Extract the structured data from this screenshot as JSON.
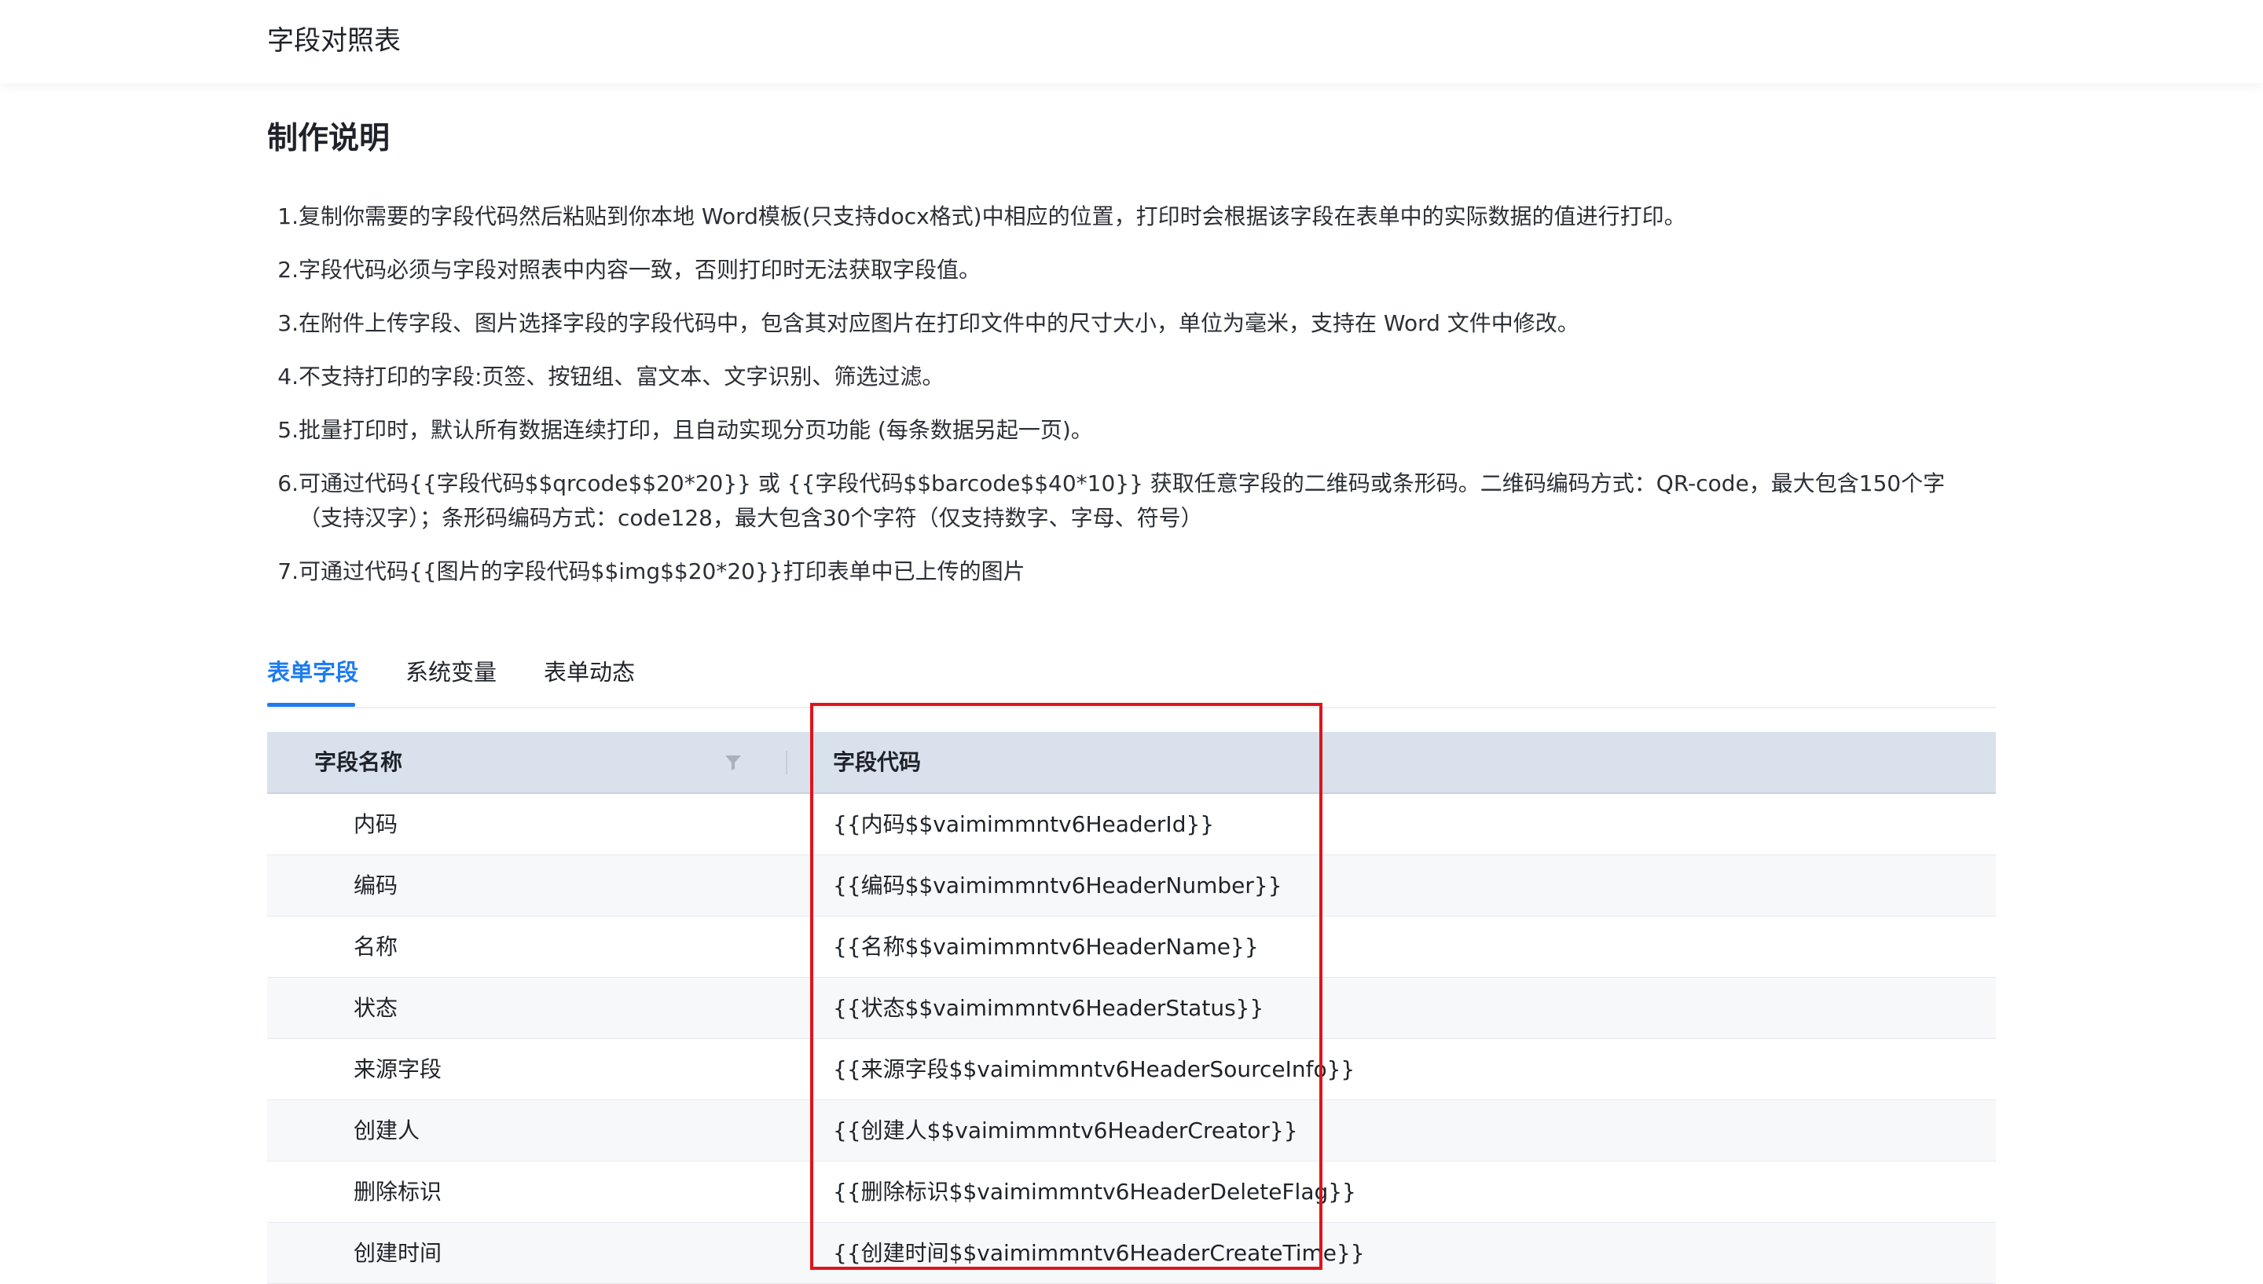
{
  "header": {
    "title": "字段对照表"
  },
  "instructions": {
    "title": "制作说明",
    "items": [
      {
        "num": "1.",
        "text": "复制你需要的字段代码然后粘贴到你本地 Word模板(只支持docx格式)中相应的位置，打印时会根据该字段在表单中的实际数据的值进行打印。"
      },
      {
        "num": "2.",
        "text": "字段代码必须与字段对照表中内容一致，否则打印时无法获取字段值。"
      },
      {
        "num": "3.",
        "text": "在附件上传字段、图片选择字段的字段代码中，包含其对应图片在打印文件中的尺寸大小，单位为毫米，支持在 Word 文件中修改。"
      },
      {
        "num": "4.",
        "text": "不支持打印的字段:页签、按钮组、富文本、文字识别、筛选过滤。"
      },
      {
        "num": "5.",
        "text": "批量打印时，默认所有数据连续打印，且自动实现分页功能 (每条数据另起一页)。"
      },
      {
        "num": "6.",
        "text": "可通过代码{{字段代码$$qrcode$$20*20}} 或 {{字段代码$$barcode$$40*10}} 获取任意字段的二维码或条形码。二维码编码方式：QR-code，最大包含150个字（支持汉字）；条形码编码方式：code128，最大包含30个字符（仅支持数字、字母、符号）"
      },
      {
        "num": "7.",
        "text": "可通过代码{{图片的字段代码$$img$$20*20}}打印表单中已上传的图片"
      }
    ]
  },
  "tabs": [
    {
      "label": "表单字段",
      "active": true
    },
    {
      "label": "系统变量",
      "active": false
    },
    {
      "label": "表单动态",
      "active": false
    }
  ],
  "table": {
    "columns": {
      "name": "字段名称",
      "code": "字段代码"
    },
    "rows": [
      {
        "name": "内码",
        "code": "{{内码$$vaimimmntv6HeaderId}}"
      },
      {
        "name": "编码",
        "code": "{{编码$$vaimimmntv6HeaderNumber}}"
      },
      {
        "name": "名称",
        "code": "{{名称$$vaimimmntv6HeaderName}}"
      },
      {
        "name": "状态",
        "code": "{{状态$$vaimimmntv6HeaderStatus}}"
      },
      {
        "name": "来源字段",
        "code": "{{来源字段$$vaimimmntv6HeaderSourceInfo}}"
      },
      {
        "name": "创建人",
        "code": "{{创建人$$vaimimmntv6HeaderCreator}}"
      },
      {
        "name": "删除标识",
        "code": "{{删除标识$$vaimimmntv6HeaderDeleteFlag}}"
      },
      {
        "name": "创建时间",
        "code": "{{创建时间$$vaimimmntv6HeaderCreateTime}}"
      }
    ]
  },
  "colors": {
    "accent": "#1e7bf0",
    "header_bg": "#d9e2ec",
    "highlight": "#e0141b"
  },
  "icons": {
    "filter": "filter-icon"
  }
}
